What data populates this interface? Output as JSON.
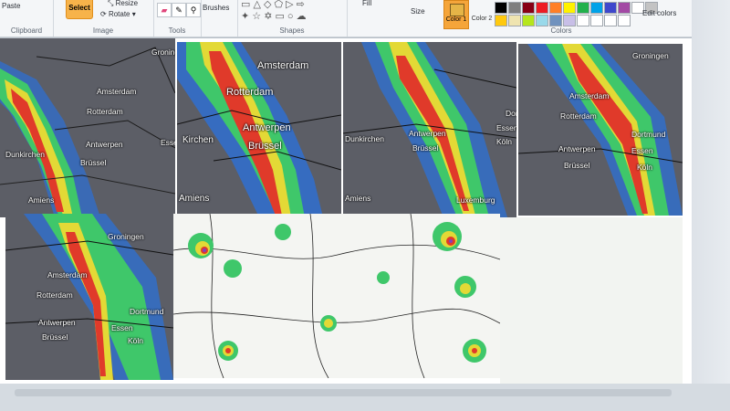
{
  "ribbon": {
    "clipboard": {
      "paste_label": "Paste",
      "group_label": "Clipboard"
    },
    "image": {
      "select_label": "Select",
      "resize_label": "Resize",
      "rotate_label": "Rotate",
      "group_label": "Image"
    },
    "tools": {
      "group_label": "Tools"
    },
    "brushes": {
      "label": "Brushes"
    },
    "shapes": {
      "group_label": "Shapes",
      "fill_label": "Fill"
    },
    "size": {
      "label": "Size"
    },
    "colors": {
      "color1_label": "Color 1",
      "color2_label": "Color 2",
      "group_label": "Colors",
      "edit_label": "Edit colors",
      "palette_row1": [
        "#000000",
        "#7f7f7f",
        "#880015",
        "#ed1c24",
        "#ff7f27",
        "#fff200",
        "#22b14c",
        "#00a2e8",
        "#3f48cc",
        "#a349a4",
        "#ffffff",
        "#c3c3c3",
        "#b97a57",
        "#ffaec9"
      ],
      "palette_row2": [
        "#ffc90e",
        "#efe4b0",
        "#b5e61d",
        "#99d9ea",
        "#7092be",
        "#c8bfe7",
        "#ffffff",
        "#ffffff",
        "#ffffff",
        "#ffffff"
      ]
    }
  },
  "maps": {
    "p1": [
      "Groningen",
      "Amsterdam",
      "Rotterdam",
      "Antwerpen",
      "Dunkirchen",
      "Brüssel",
      "Essen",
      "Amiens"
    ],
    "p2": [
      "Amsterdam",
      "Rotterdam",
      "Antwerpen",
      "Brüssel",
      "Kirchen",
      "Amiens"
    ],
    "p3": [
      "Dort",
      "Essen",
      "Köln",
      "Dunkirchen",
      "Antwerpen",
      "Brüssel",
      "Amiens",
      "Luxemburg"
    ],
    "p4": [
      "Groningen",
      "Amsterdam",
      "Rotterdam",
      "Antwerpen",
      "Brüssel",
      "Dortmund",
      "Essen",
      "Köln"
    ],
    "p5": [
      "Groningen",
      "Amsterdam",
      "Rotterdam",
      "Antwerpen",
      "Brüssel",
      "Dortmund",
      "Essen",
      "Köln"
    ]
  }
}
